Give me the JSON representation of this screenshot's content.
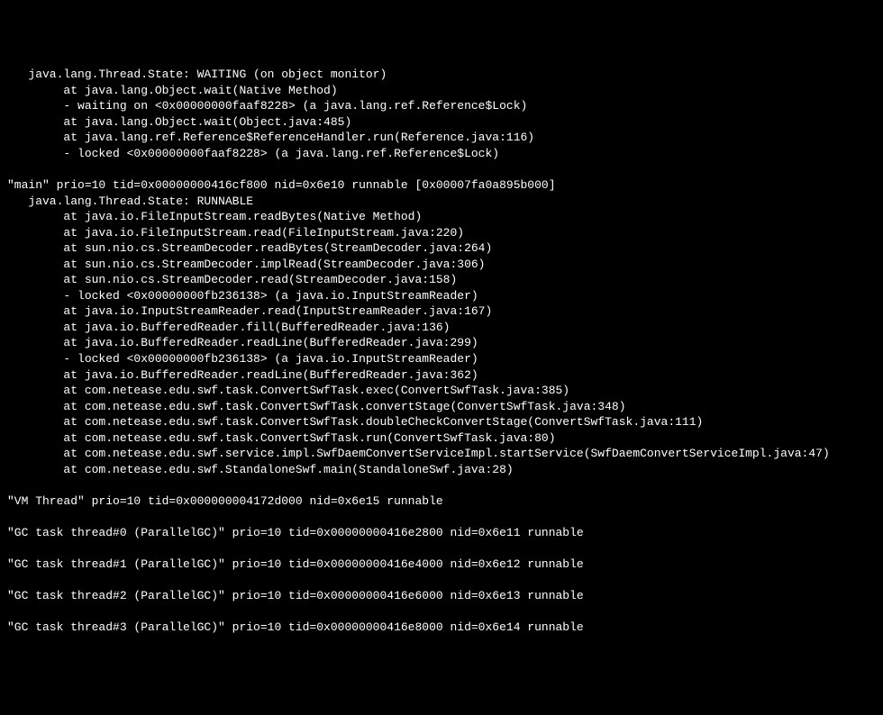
{
  "terminal": {
    "lines": [
      "   java.lang.Thread.State: WAITING (on object monitor)",
      "        at java.lang.Object.wait(Native Method)",
      "        - waiting on <0x00000000faaf8228> (a java.lang.ref.Reference$Lock)",
      "        at java.lang.Object.wait(Object.java:485)",
      "        at java.lang.ref.Reference$ReferenceHandler.run(Reference.java:116)",
      "        - locked <0x00000000faaf8228> (a java.lang.ref.Reference$Lock)",
      "",
      "\"main\" prio=10 tid=0x00000000416cf800 nid=0x6e10 runnable [0x00007fa0a895b000]",
      "   java.lang.Thread.State: RUNNABLE",
      "        at java.io.FileInputStream.readBytes(Native Method)",
      "        at java.io.FileInputStream.read(FileInputStream.java:220)",
      "        at sun.nio.cs.StreamDecoder.readBytes(StreamDecoder.java:264)",
      "        at sun.nio.cs.StreamDecoder.implRead(StreamDecoder.java:306)",
      "        at sun.nio.cs.StreamDecoder.read(StreamDecoder.java:158)",
      "        - locked <0x00000000fb236138> (a java.io.InputStreamReader)",
      "        at java.io.InputStreamReader.read(InputStreamReader.java:167)",
      "        at java.io.BufferedReader.fill(BufferedReader.java:136)",
      "        at java.io.BufferedReader.readLine(BufferedReader.java:299)",
      "        - locked <0x00000000fb236138> (a java.io.InputStreamReader)",
      "        at java.io.BufferedReader.readLine(BufferedReader.java:362)",
      "        at com.netease.edu.swf.task.ConvertSwfTask.exec(ConvertSwfTask.java:385)",
      "        at com.netease.edu.swf.task.ConvertSwfTask.convertStage(ConvertSwfTask.java:348)",
      "        at com.netease.edu.swf.task.ConvertSwfTask.doubleCheckConvertStage(ConvertSwfTask.java:111)",
      "        at com.netease.edu.swf.task.ConvertSwfTask.run(ConvertSwfTask.java:80)",
      "        at com.netease.edu.swf.service.impl.SwfDaemConvertServiceImpl.startService(SwfDaemConvertServiceImpl.java:47)",
      "        at com.netease.edu.swf.StandaloneSwf.main(StandaloneSwf.java:28)",
      "",
      "\"VM Thread\" prio=10 tid=0x000000004172d000 nid=0x6e15 runnable",
      "",
      "\"GC task thread#0 (ParallelGC)\" prio=10 tid=0x00000000416e2800 nid=0x6e11 runnable",
      "",
      "\"GC task thread#1 (ParallelGC)\" prio=10 tid=0x00000000416e4000 nid=0x6e12 runnable",
      "",
      "\"GC task thread#2 (ParallelGC)\" prio=10 tid=0x00000000416e6000 nid=0x6e13 runnable",
      "",
      "\"GC task thread#3 (ParallelGC)\" prio=10 tid=0x00000000416e8000 nid=0x6e14 runnable"
    ]
  }
}
